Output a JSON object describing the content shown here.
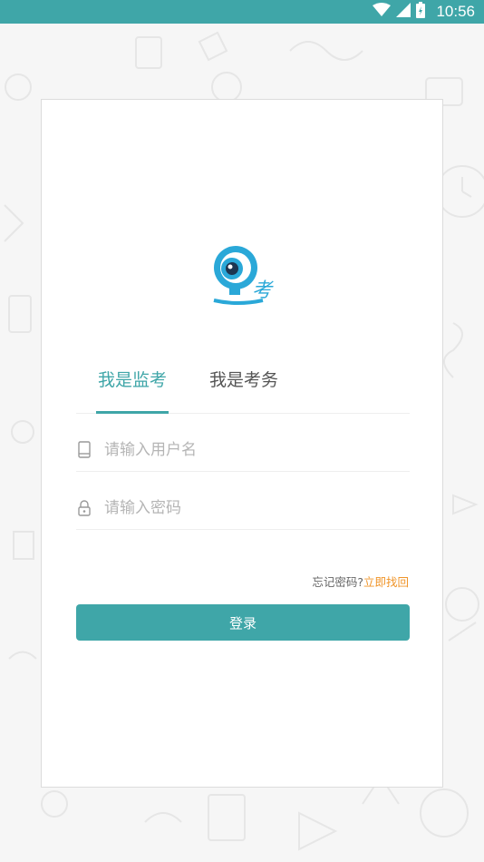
{
  "status_bar": {
    "time": "10:56",
    "icons": [
      "wifi-icon",
      "signal-icon",
      "battery-charging-icon"
    ]
  },
  "logo": {
    "icon": "webcam-logo-icon",
    "text": "考"
  },
  "tabs": [
    {
      "label": "我是监考",
      "active": true
    },
    {
      "label": "我是考务",
      "active": false
    }
  ],
  "form": {
    "username": {
      "placeholder": "请输入用户名",
      "value": "",
      "icon": "phone-icon"
    },
    "password": {
      "placeholder": "请输入密码",
      "value": "",
      "icon": "lock-icon"
    }
  },
  "forgot": {
    "text": "忘记密码?",
    "link": "立即找回"
  },
  "login_button": "登录",
  "colors": {
    "accent": "#3fa6a8",
    "link": "#f0952a",
    "logo_blue": "#2aa8d8"
  }
}
